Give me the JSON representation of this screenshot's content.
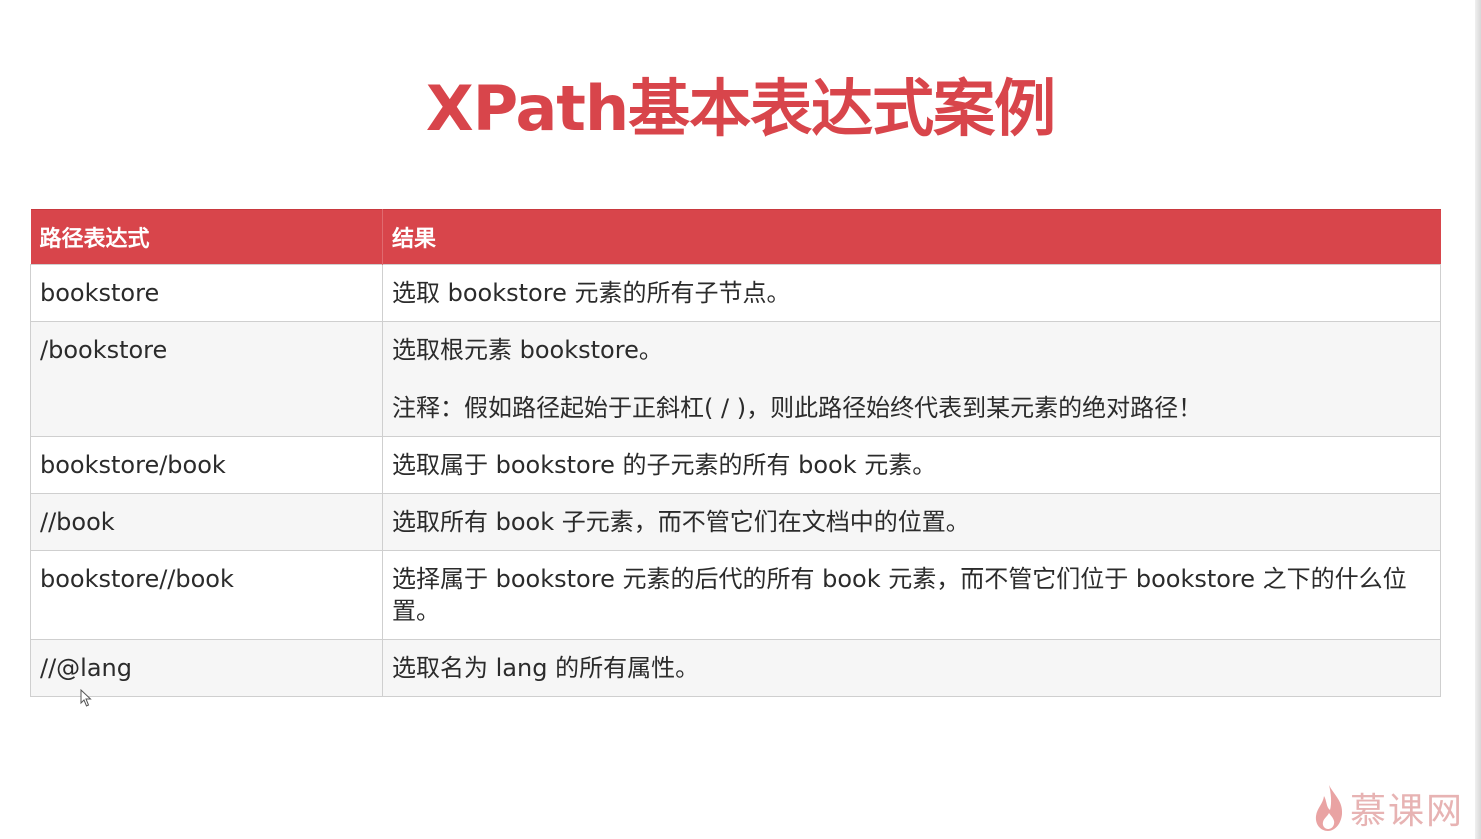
{
  "title": "XPath基本表达式案例",
  "table": {
    "headers": [
      "路径表达式",
      "结果"
    ],
    "rows": [
      {
        "path": "bookstore",
        "result": "选取 bookstore 元素的所有子节点。",
        "note": ""
      },
      {
        "path": "/bookstore",
        "result": "选取根元素 bookstore。",
        "note": "注释：假如路径起始于正斜杠( / )，则此路径始终代表到某元素的绝对路径！"
      },
      {
        "path": "bookstore/book",
        "result": "选取属于 bookstore 的子元素的所有 book 元素。",
        "note": ""
      },
      {
        "path": "//book",
        "result": "选取所有 book 子元素，而不管它们在文档中的位置。",
        "note": ""
      },
      {
        "path": "bookstore//book",
        "result": "选择属于 bookstore 元素的后代的所有 book 元素，而不管它们位于 bookstore 之下的什么位置。",
        "note": ""
      },
      {
        "path": "//@lang",
        "result": "选取名为 lang 的所有属性。",
        "note": ""
      }
    ]
  },
  "watermark": {
    "text": "慕课网",
    "icon": "flame-icon"
  },
  "colors": {
    "accent": "#d8454b",
    "header_text": "#ffffff",
    "watermark": "#e7b3b3"
  }
}
